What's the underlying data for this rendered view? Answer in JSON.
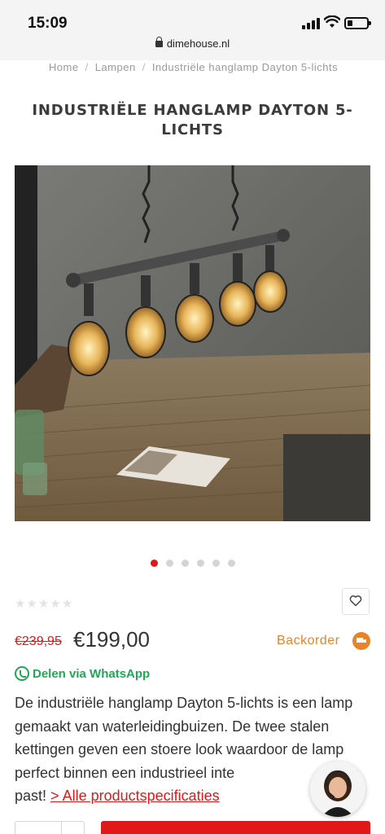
{
  "status": {
    "time": "15:09",
    "url": "dimehouse.nl"
  },
  "breadcrumb": {
    "items": [
      "Home",
      "Lampen",
      "Industriële hanglamp Dayton 5-lichts"
    ]
  },
  "product": {
    "title": "INDUSTRIËLE HANGLAMP DAYTON 5-LICHTS",
    "image_alt": "Industriële hanglamp Dayton 5-lichts boven een houten tafel",
    "image_count": 6,
    "active_image": 1,
    "rating_stars": 5,
    "rating_value": 0,
    "old_price": "€239,95",
    "price": "€199,00",
    "stock_status": "Backorder",
    "whatsapp_label": "Delen via WhatsApp",
    "description": "De industriële hanglamp Dayton 5-lichts is een lamp gemaakt van waterleidingbuizen. De twee stalen kettingen geven een stoere look waardoor de lamp perfect binnen een industrieel inte",
    "description_end": "past!",
    "specs_link": "> Alle productspecificaties"
  },
  "icons": {
    "wishlist": "heart-icon",
    "stock": "truck-icon",
    "share": "whatsapp-icon",
    "chat": "chat-agent-avatar"
  },
  "colors": {
    "accent": "#e2171a",
    "stock": "#e8832a",
    "whatsapp": "#1fa855",
    "title": "#3b3b3b"
  }
}
